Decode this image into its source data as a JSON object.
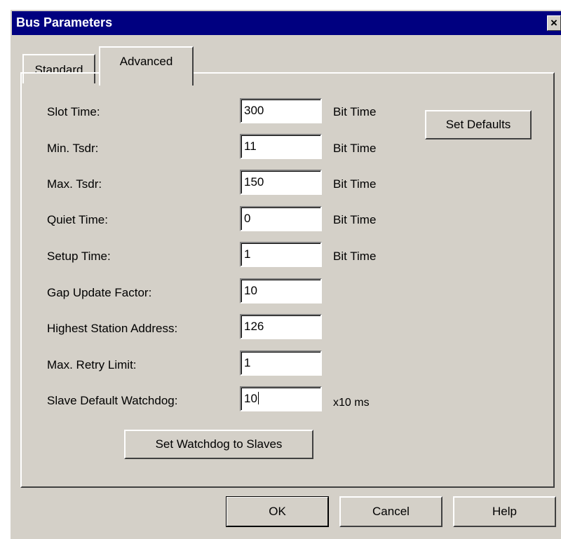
{
  "dialog": {
    "title": "Bus Parameters",
    "close_glyph": "×",
    "tabs": [
      {
        "label": "Standard"
      },
      {
        "label": "Advanced"
      }
    ],
    "active_tab": "Advanced"
  },
  "params": [
    {
      "label": "Slot Time:",
      "value": "300",
      "unit": "Bit Time"
    },
    {
      "label": "Min. Tsdr:",
      "value": "11",
      "unit": "Bit Time"
    },
    {
      "label": "Max. Tsdr:",
      "value": "150",
      "unit": "Bit Time"
    },
    {
      "label": "Quiet Time:",
      "value": "0",
      "unit": "Bit Time"
    },
    {
      "label": "Setup Time:",
      "value": "1",
      "unit": "Bit Time"
    },
    {
      "label": "Gap Update Factor:",
      "value": "10",
      "unit": ""
    },
    {
      "label": "Highest Station Address:",
      "value": "126",
      "unit": ""
    },
    {
      "label": "Max. Retry Limit:",
      "value": "1",
      "unit": ""
    },
    {
      "label": "Slave Default Watchdog:",
      "value": "10",
      "unit": "x10 ms"
    }
  ],
  "buttons": {
    "set_defaults": "Set Defaults",
    "set_watchdog": "Set Watchdog to Slaves",
    "ok": "OK",
    "cancel": "Cancel",
    "help": "Help"
  },
  "colors": {
    "titlebar": "#000080",
    "face": "#d4d0c8"
  }
}
